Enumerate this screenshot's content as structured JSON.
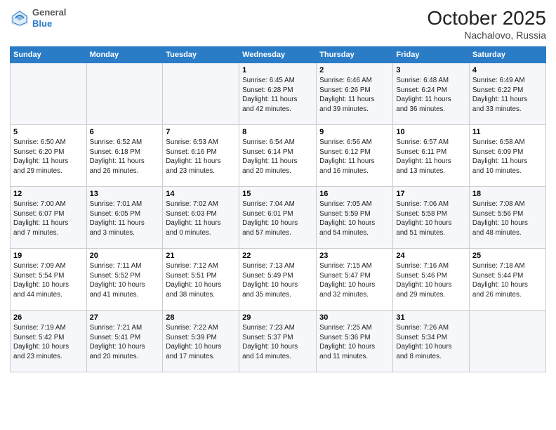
{
  "header": {
    "logo": {
      "general": "General",
      "blue": "Blue"
    },
    "title": "October 2025",
    "location": "Nachalovo, Russia"
  },
  "weekdays": [
    "Sunday",
    "Monday",
    "Tuesday",
    "Wednesday",
    "Thursday",
    "Friday",
    "Saturday"
  ],
  "weeks": [
    [
      {
        "day": "",
        "info": ""
      },
      {
        "day": "",
        "info": ""
      },
      {
        "day": "",
        "info": ""
      },
      {
        "day": "1",
        "info": "Sunrise: 6:45 AM\nSunset: 6:28 PM\nDaylight: 11 hours\nand 42 minutes."
      },
      {
        "day": "2",
        "info": "Sunrise: 6:46 AM\nSunset: 6:26 PM\nDaylight: 11 hours\nand 39 minutes."
      },
      {
        "day": "3",
        "info": "Sunrise: 6:48 AM\nSunset: 6:24 PM\nDaylight: 11 hours\nand 36 minutes."
      },
      {
        "day": "4",
        "info": "Sunrise: 6:49 AM\nSunset: 6:22 PM\nDaylight: 11 hours\nand 33 minutes."
      }
    ],
    [
      {
        "day": "5",
        "info": "Sunrise: 6:50 AM\nSunset: 6:20 PM\nDaylight: 11 hours\nand 29 minutes."
      },
      {
        "day": "6",
        "info": "Sunrise: 6:52 AM\nSunset: 6:18 PM\nDaylight: 11 hours\nand 26 minutes."
      },
      {
        "day": "7",
        "info": "Sunrise: 6:53 AM\nSunset: 6:16 PM\nDaylight: 11 hours\nand 23 minutes."
      },
      {
        "day": "8",
        "info": "Sunrise: 6:54 AM\nSunset: 6:14 PM\nDaylight: 11 hours\nand 20 minutes."
      },
      {
        "day": "9",
        "info": "Sunrise: 6:56 AM\nSunset: 6:12 PM\nDaylight: 11 hours\nand 16 minutes."
      },
      {
        "day": "10",
        "info": "Sunrise: 6:57 AM\nSunset: 6:11 PM\nDaylight: 11 hours\nand 13 minutes."
      },
      {
        "day": "11",
        "info": "Sunrise: 6:58 AM\nSunset: 6:09 PM\nDaylight: 11 hours\nand 10 minutes."
      }
    ],
    [
      {
        "day": "12",
        "info": "Sunrise: 7:00 AM\nSunset: 6:07 PM\nDaylight: 11 hours\nand 7 minutes."
      },
      {
        "day": "13",
        "info": "Sunrise: 7:01 AM\nSunset: 6:05 PM\nDaylight: 11 hours\nand 3 minutes."
      },
      {
        "day": "14",
        "info": "Sunrise: 7:02 AM\nSunset: 6:03 PM\nDaylight: 11 hours\nand 0 minutes."
      },
      {
        "day": "15",
        "info": "Sunrise: 7:04 AM\nSunset: 6:01 PM\nDaylight: 10 hours\nand 57 minutes."
      },
      {
        "day": "16",
        "info": "Sunrise: 7:05 AM\nSunset: 5:59 PM\nDaylight: 10 hours\nand 54 minutes."
      },
      {
        "day": "17",
        "info": "Sunrise: 7:06 AM\nSunset: 5:58 PM\nDaylight: 10 hours\nand 51 minutes."
      },
      {
        "day": "18",
        "info": "Sunrise: 7:08 AM\nSunset: 5:56 PM\nDaylight: 10 hours\nand 48 minutes."
      }
    ],
    [
      {
        "day": "19",
        "info": "Sunrise: 7:09 AM\nSunset: 5:54 PM\nDaylight: 10 hours\nand 44 minutes."
      },
      {
        "day": "20",
        "info": "Sunrise: 7:11 AM\nSunset: 5:52 PM\nDaylight: 10 hours\nand 41 minutes."
      },
      {
        "day": "21",
        "info": "Sunrise: 7:12 AM\nSunset: 5:51 PM\nDaylight: 10 hours\nand 38 minutes."
      },
      {
        "day": "22",
        "info": "Sunrise: 7:13 AM\nSunset: 5:49 PM\nDaylight: 10 hours\nand 35 minutes."
      },
      {
        "day": "23",
        "info": "Sunrise: 7:15 AM\nSunset: 5:47 PM\nDaylight: 10 hours\nand 32 minutes."
      },
      {
        "day": "24",
        "info": "Sunrise: 7:16 AM\nSunset: 5:46 PM\nDaylight: 10 hours\nand 29 minutes."
      },
      {
        "day": "25",
        "info": "Sunrise: 7:18 AM\nSunset: 5:44 PM\nDaylight: 10 hours\nand 26 minutes."
      }
    ],
    [
      {
        "day": "26",
        "info": "Sunrise: 7:19 AM\nSunset: 5:42 PM\nDaylight: 10 hours\nand 23 minutes."
      },
      {
        "day": "27",
        "info": "Sunrise: 7:21 AM\nSunset: 5:41 PM\nDaylight: 10 hours\nand 20 minutes."
      },
      {
        "day": "28",
        "info": "Sunrise: 7:22 AM\nSunset: 5:39 PM\nDaylight: 10 hours\nand 17 minutes."
      },
      {
        "day": "29",
        "info": "Sunrise: 7:23 AM\nSunset: 5:37 PM\nDaylight: 10 hours\nand 14 minutes."
      },
      {
        "day": "30",
        "info": "Sunrise: 7:25 AM\nSunset: 5:36 PM\nDaylight: 10 hours\nand 11 minutes."
      },
      {
        "day": "31",
        "info": "Sunrise: 7:26 AM\nSunset: 5:34 PM\nDaylight: 10 hours\nand 8 minutes."
      },
      {
        "day": "",
        "info": ""
      }
    ]
  ]
}
